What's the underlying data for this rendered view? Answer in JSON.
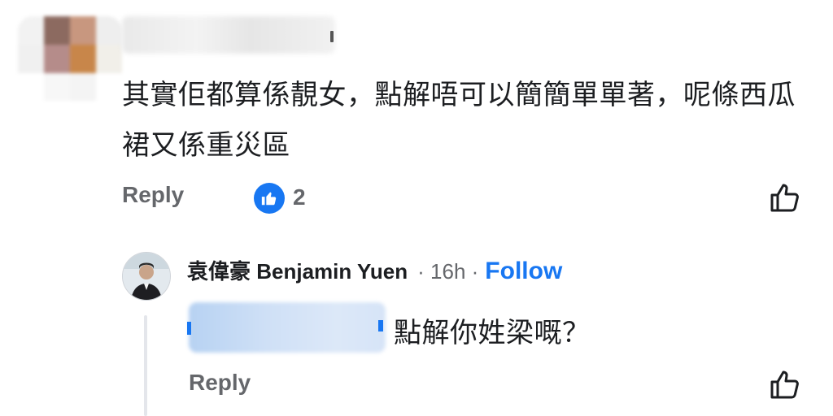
{
  "comment": {
    "text": "其實佢都算係靚女，點解唔可以簡簡單單著，呢條西瓜裙又係重災區",
    "reply_label": "Reply",
    "reaction_count": "2"
  },
  "reply": {
    "author_name": "袁偉豪 Benjamin Yuen",
    "time": "· 16h ·",
    "follow_label": "Follow",
    "text": "點解你姓梁嘅？",
    "reply_label": "Reply"
  },
  "colors": {
    "accent": "#1877f2",
    "secondary_text": "#65676b",
    "primary_text": "#1c1e21",
    "thread_line": "#e4e6eb"
  },
  "icons": {
    "reaction": "like-thumbs-up-icon",
    "like_action": "thumbs-up-outline-icon"
  }
}
